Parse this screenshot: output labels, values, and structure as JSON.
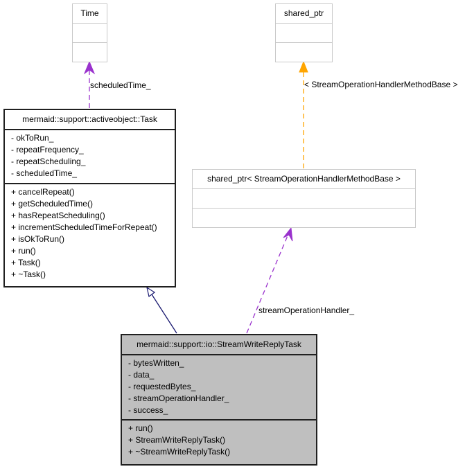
{
  "diagram": {
    "type": "uml-collaboration-diagram",
    "classes": {
      "time": {
        "name": "Time",
        "attributes": [],
        "methods": []
      },
      "shared_ptr": {
        "name": "shared_ptr",
        "attributes": [],
        "methods": []
      },
      "task": {
        "name": "mermaid::support::activeobject::Task",
        "attributes": [
          "- okToRun_",
          "- repeatFrequency_",
          "- repeatScheduling_",
          "- scheduledTime_"
        ],
        "methods": [
          "+ cancelRepeat()",
          "+ getScheduledTime()",
          "+ hasRepeatScheduling()",
          "+ incrementScheduledTimeForRepeat()",
          "+ isOkToRun()",
          "+ run()",
          "+ Task()",
          "+ ~Task()"
        ]
      },
      "shared_ptr_inst": {
        "name": "shared_ptr< StreamOperationHandlerMethodBase >",
        "attributes": [],
        "methods": []
      },
      "stream_write_reply_task": {
        "name": "mermaid::support::io::StreamWriteReplyTask",
        "attributes": [
          "- bytesWritten_",
          "- data_",
          "- requestedBytes_",
          "- streamOperationHandler_",
          "- success_"
        ],
        "methods": [
          "+ run()",
          "+ StreamWriteReplyTask()",
          "+ ~StreamWriteReplyTask()"
        ]
      }
    },
    "edges": {
      "task_to_time": {
        "label": "scheduledTime_",
        "kind": "usage",
        "color": "#9a32cd"
      },
      "inst_to_shared_ptr": {
        "label": "< StreamOperationHandlerMethodBase >",
        "kind": "template-instance",
        "color": "#ffa500"
      },
      "swrt_to_inst": {
        "label": "streamOperationHandler_",
        "kind": "usage",
        "color": "#9a32cd"
      },
      "swrt_to_task": {
        "label": "",
        "kind": "inheritance",
        "color": "#191970"
      }
    }
  }
}
